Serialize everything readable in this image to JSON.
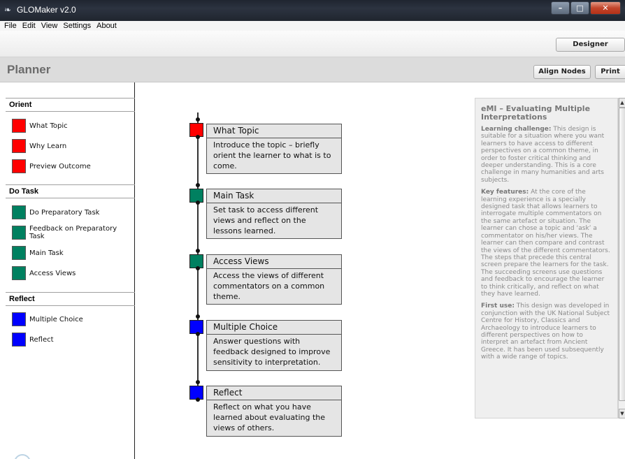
{
  "window": {
    "title": "GLOMaker v2.0",
    "icon": "feather-icon"
  },
  "menu": [
    "File",
    "Edit",
    "View",
    "Settings",
    "About"
  ],
  "toolbar": {
    "designer_label": "Designer"
  },
  "planner": {
    "title": "Planner",
    "align_label": "Align Nodes",
    "print_label": "Print"
  },
  "colors": {
    "orient": "#ff0000",
    "do_task": "#008060",
    "reflect": "#0000ff"
  },
  "sidebar": {
    "sections": [
      {
        "title": "Orient",
        "items": [
          "What Topic",
          "Why Learn",
          "Preview Outcome"
        ]
      },
      {
        "title": "Do Task",
        "items": [
          "Do Preparatory Task",
          "Feedback on Preparatory Task",
          "Main Task",
          "Access Views"
        ]
      },
      {
        "title": "Reflect",
        "items": [
          "Multiple Choice",
          "Reflect"
        ]
      }
    ]
  },
  "nodes": [
    {
      "title": "What Topic",
      "desc": "Introduce the topic – briefly orient the learner to what is to come."
    },
    {
      "title": "Main Task",
      "desc": "Set task to access different views and reflect on the lessons learned."
    },
    {
      "title": "Access Views",
      "desc": "Access the views of different commentators on a common theme."
    },
    {
      "title": "Multiple Choice",
      "desc": "Answer questions with feedback designed to improve sensitivity to interpretation."
    },
    {
      "title": "Reflect",
      "desc": "Reflect on what you have learned about evaluating the views of others."
    }
  ],
  "info": {
    "heading": "eMI – Evaluating Multiple Interpretations",
    "p1_label": "Learning challenge:",
    "p1_text": " This design is suitable for a situation where you want learners to have access to different perspectives on a common theme, in order to foster critical thinking and deeper understanding. This is a core challenge in many humanities and arts subjects.",
    "p2_label": "Key features:",
    "p2_text": " At the core of the learning experience is a specially designed task that allows learners to interrogate multiple commentators on the same artefact or situation. The learner can chose a topic and ‘ask’ a commentator on his/her views. The learner can then compare and contrast the views of the different commentators. The steps that precede this central screen prepare the learners for the task. The succeeding screens use questions and feedback to encourage the learner to think critically, and reflect on what they have learned.",
    "p3_label": "First use:",
    "p3_text": " This design was developed in conjunction with the UK National Subject Centre for History, Classics and Archaeology to introduce learners to different perspectives on how to interpret an artefact from Ancient Greece. It has been used subsequently with a wide range of topics."
  }
}
